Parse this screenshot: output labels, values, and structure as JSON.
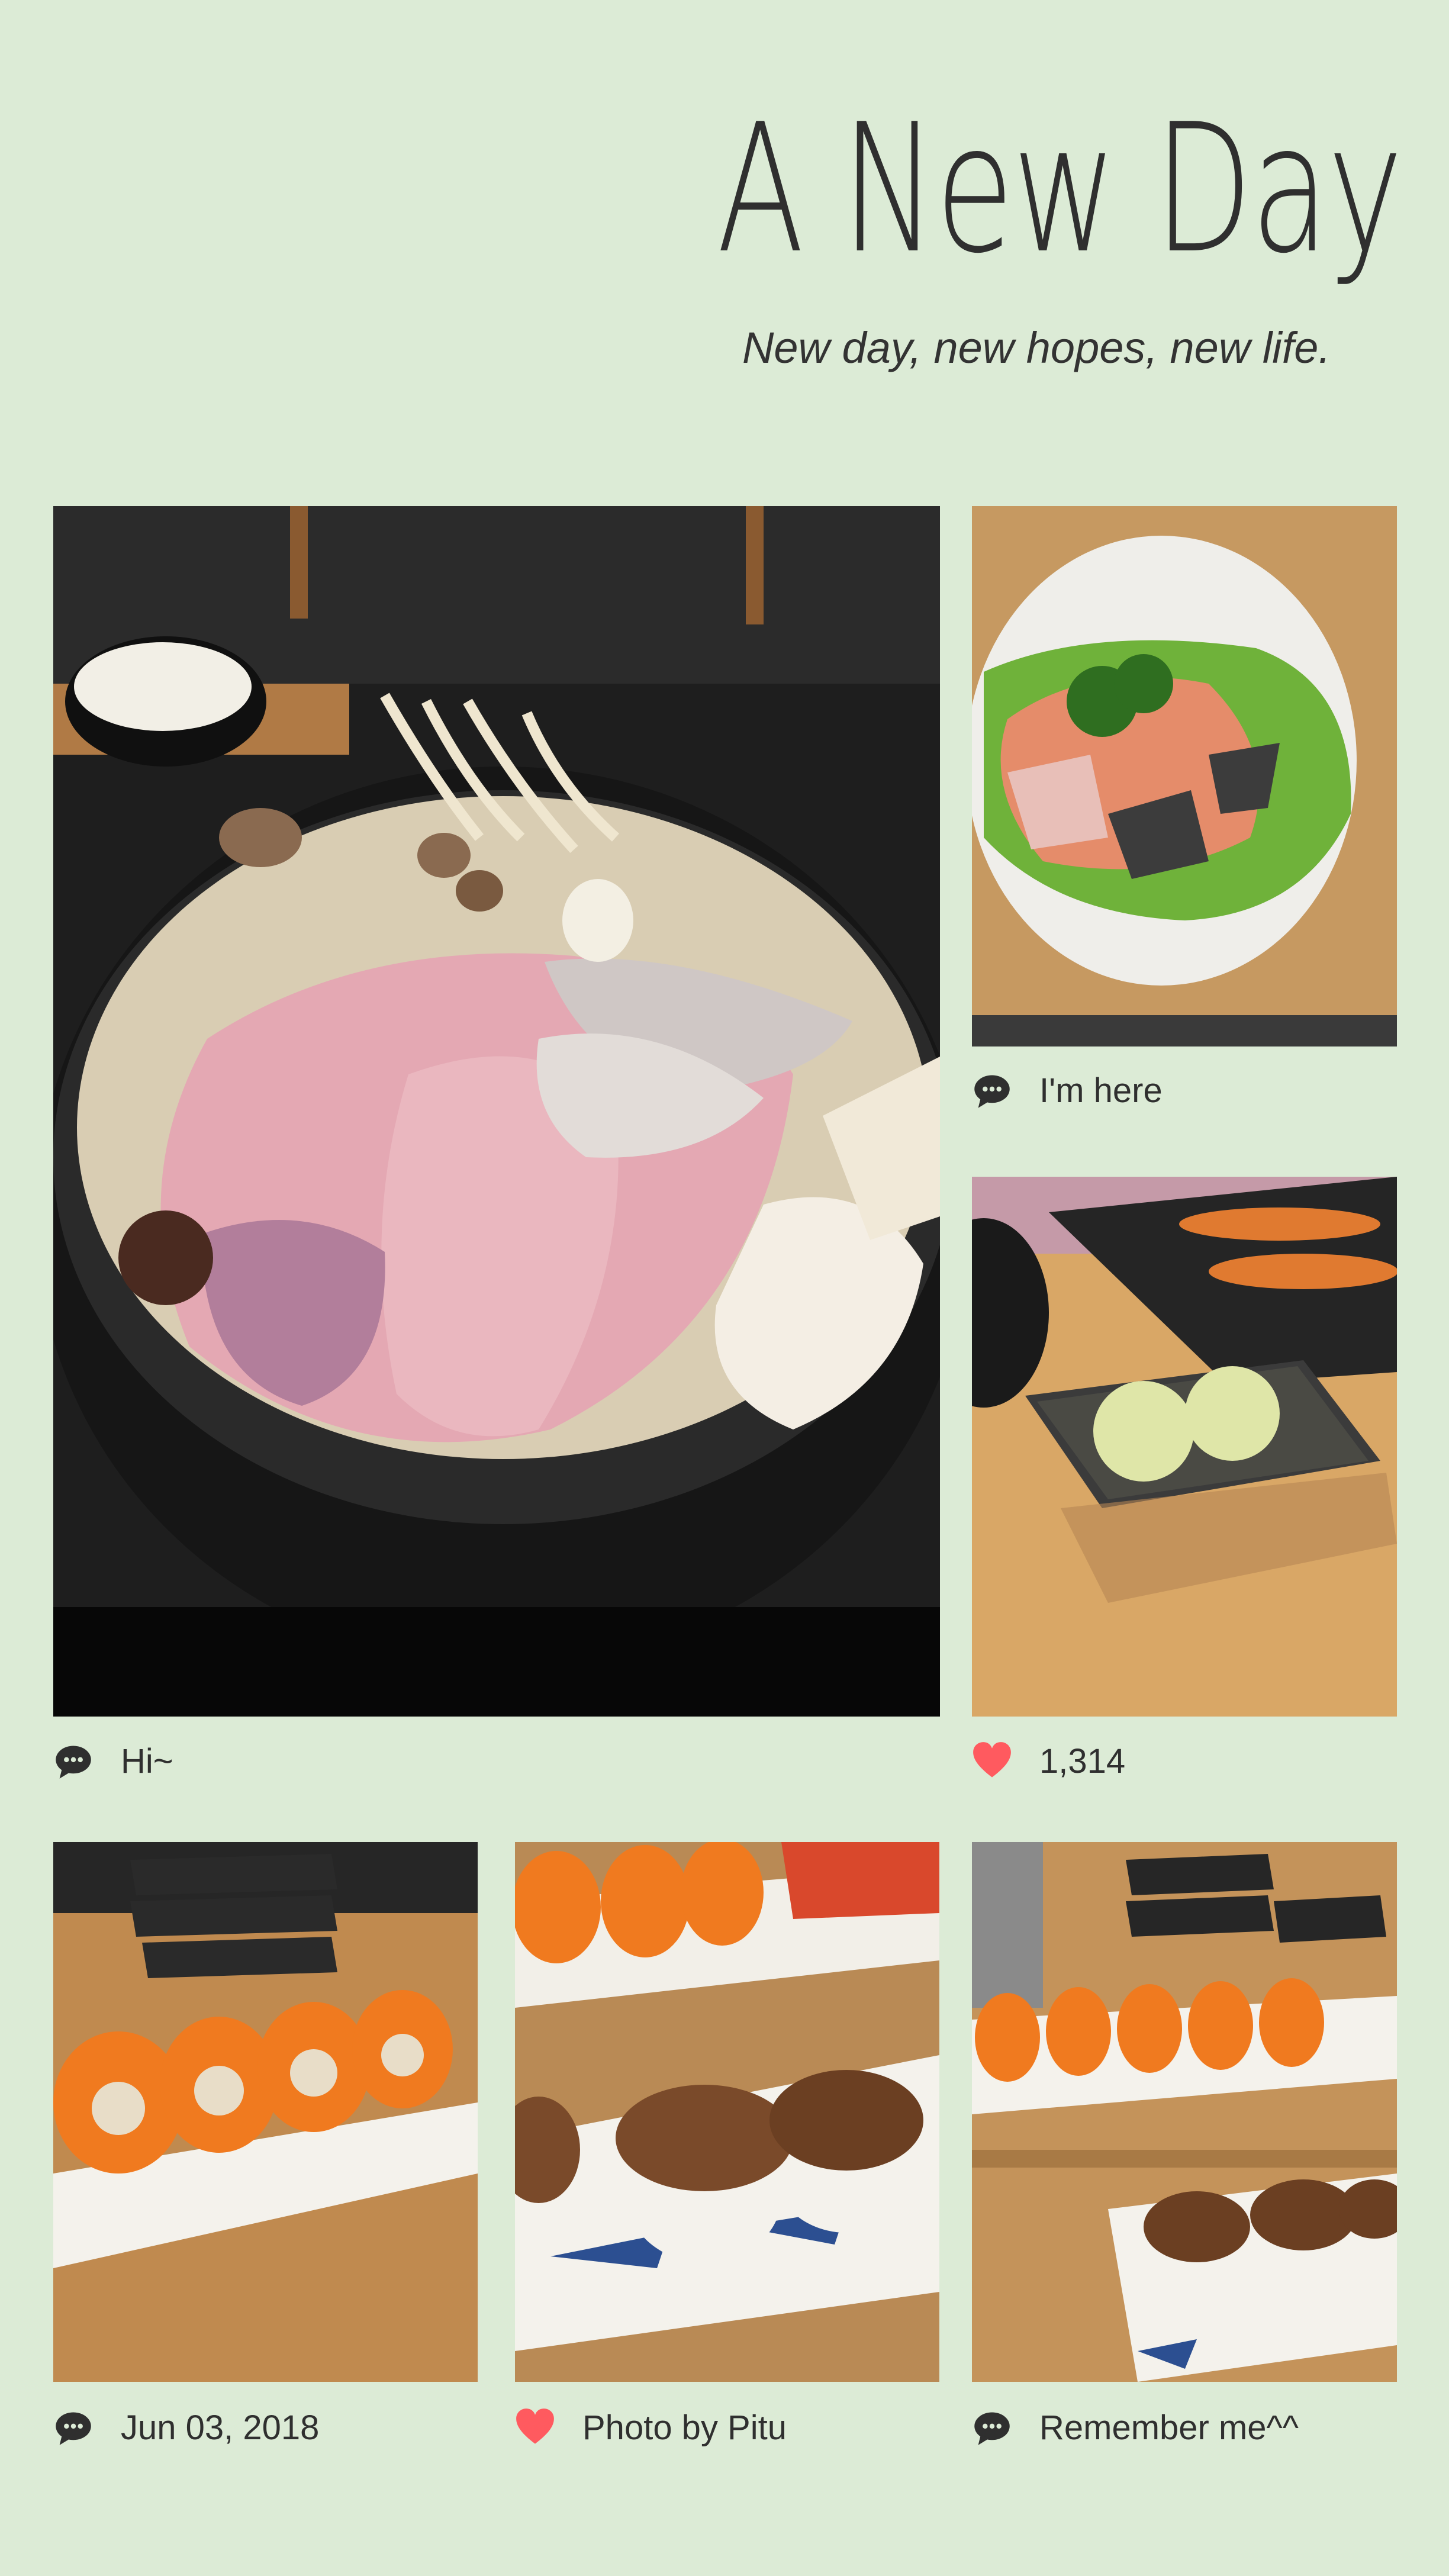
{
  "header": {
    "title": "A New Day",
    "subtitle": "New day, new hopes, new life."
  },
  "colors": {
    "background": "#dcebd6",
    "text": "#2f2f2f",
    "heart": "#ff5a5f"
  },
  "posts": [
    {
      "caption": "Hi~",
      "icon": "comment-icon",
      "photo": "hotpot-with-mushrooms-and-sliced-meat"
    },
    {
      "caption": "I'm here",
      "icon": "comment-icon",
      "photo": "salmon-sashimi-plate"
    },
    {
      "caption": "1,314",
      "icon": "heart-icon",
      "photo": "wasabi-dish-and-menu"
    },
    {
      "caption": "Jun 03, 2018",
      "icon": "comment-icon",
      "photo": "tobiko-sushi-rolls"
    },
    {
      "caption": "Photo by Pitu",
      "icon": "heart-icon",
      "photo": "grilled-eel-sushi"
    },
    {
      "caption": "Remember me^^",
      "icon": "comment-icon",
      "photo": "sushi-platters-on-table"
    }
  ]
}
